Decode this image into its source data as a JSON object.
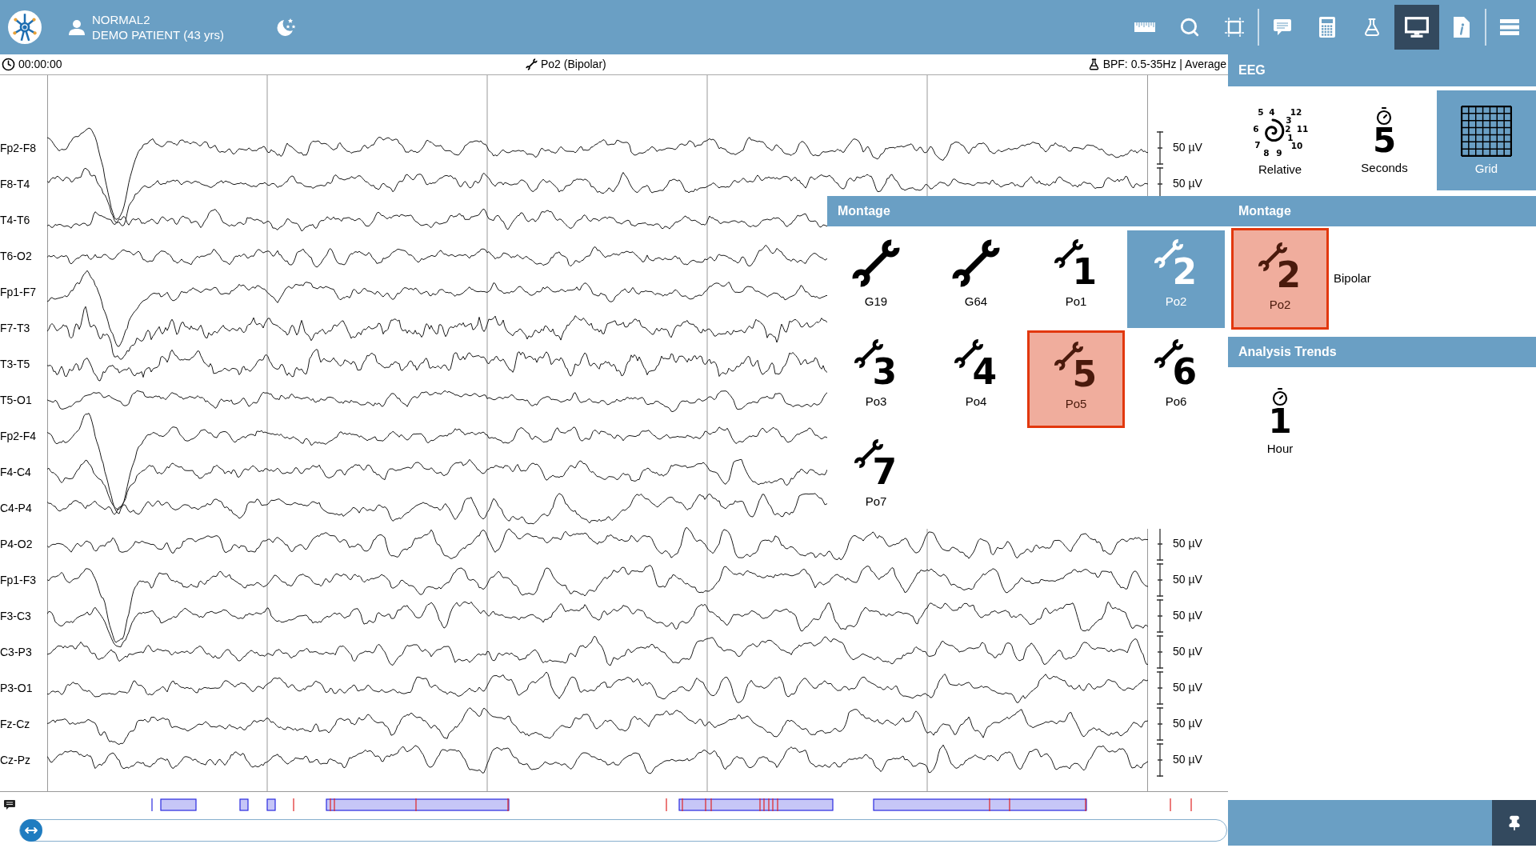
{
  "header": {
    "record": "NORMAL2",
    "patient": "DEMO PATIENT (43 yrs)"
  },
  "toolbar": [
    {
      "items": [
        {
          "kind": "measure",
          "selected": false
        },
        {
          "kind": "zoom",
          "selected": false
        },
        {
          "kind": "select",
          "selected": false
        }
      ]
    },
    {
      "items": [
        {
          "kind": "comments",
          "selected": false
        },
        {
          "kind": "calculator",
          "selected": false
        },
        {
          "kind": "lab",
          "selected": false
        },
        {
          "kind": "display",
          "selected": true
        },
        {
          "kind": "info",
          "selected": false
        }
      ]
    },
    {
      "items": [
        {
          "kind": "menu",
          "selected": false
        }
      ]
    }
  ],
  "status_bar": {
    "time": "00:00:00",
    "montage": "Po2 (Bipolar)",
    "filter": "BPF: 0.5-35Hz | Average"
  },
  "channels": [
    {
      "name": "Fp2-F8",
      "scale": "50 µV"
    },
    {
      "name": "F8-T4",
      "scale": "50 µV"
    },
    {
      "name": "T4-T6"
    },
    {
      "name": "T6-O2"
    },
    {
      "name": "Fp1-F7"
    },
    {
      "name": "F7-T3"
    },
    {
      "name": "T3-T5"
    },
    {
      "name": "T5-O1"
    },
    {
      "name": "Fp2-F4"
    },
    {
      "name": "F4-C4"
    },
    {
      "name": "C4-P4"
    },
    {
      "name": "P4-O2",
      "scale": "50 µV"
    },
    {
      "name": "Fp1-F3",
      "scale": "50 µV"
    },
    {
      "name": "F3-C3",
      "scale": "50 µV"
    },
    {
      "name": "C3-P3",
      "scale": "50 µV"
    },
    {
      "name": "P3-O1",
      "scale": "50 µV"
    },
    {
      "name": "Fz-Cz",
      "scale": "50 µV"
    },
    {
      "name": "Cz-Pz",
      "scale": "50 µV"
    }
  ],
  "montage_popup": {
    "title": "Montage",
    "items": [
      {
        "label": "G19",
        "selected": false,
        "focused": false
      },
      {
        "label": "G64",
        "selected": false,
        "focused": false
      },
      {
        "label": "Po1",
        "number": "1",
        "selected": false,
        "focused": false
      },
      {
        "label": "Po2",
        "number": "2",
        "selected": true,
        "focused": false
      },
      {
        "label": "Po3",
        "number": "3",
        "selected": false,
        "focused": false
      },
      {
        "label": "Po4",
        "number": "4",
        "selected": false,
        "focused": false
      },
      {
        "label": "Po5",
        "number": "5",
        "selected": false,
        "focused": true
      },
      {
        "label": "Po6",
        "number": "6",
        "selected": false,
        "focused": false
      },
      {
        "label": "Po7",
        "number": "7",
        "selected": false,
        "focused": false
      }
    ]
  },
  "side_panel": {
    "eeg": {
      "title": "EEG",
      "options": [
        {
          "kind": "dial",
          "marks": [
            "5",
            "4",
            "12",
            "3",
            "6",
            "2",
            "11",
            "1",
            "7",
            "10",
            "8",
            "9"
          ],
          "label": "Relative",
          "selected": false
        },
        {
          "kind": "timer",
          "value": "5",
          "label": "Seconds",
          "selected": false
        },
        {
          "kind": "grid",
          "label": "Grid",
          "selected": true
        }
      ]
    },
    "montage": {
      "title": "Montage",
      "current": {
        "number": "2",
        "label": "Po2",
        "focused": true
      },
      "description": "Bipolar"
    },
    "analysis_trends": {
      "title": "Analysis Trends",
      "options": [
        {
          "kind": "timer",
          "value": "1",
          "label": "Hour",
          "selected": false
        }
      ]
    }
  }
}
